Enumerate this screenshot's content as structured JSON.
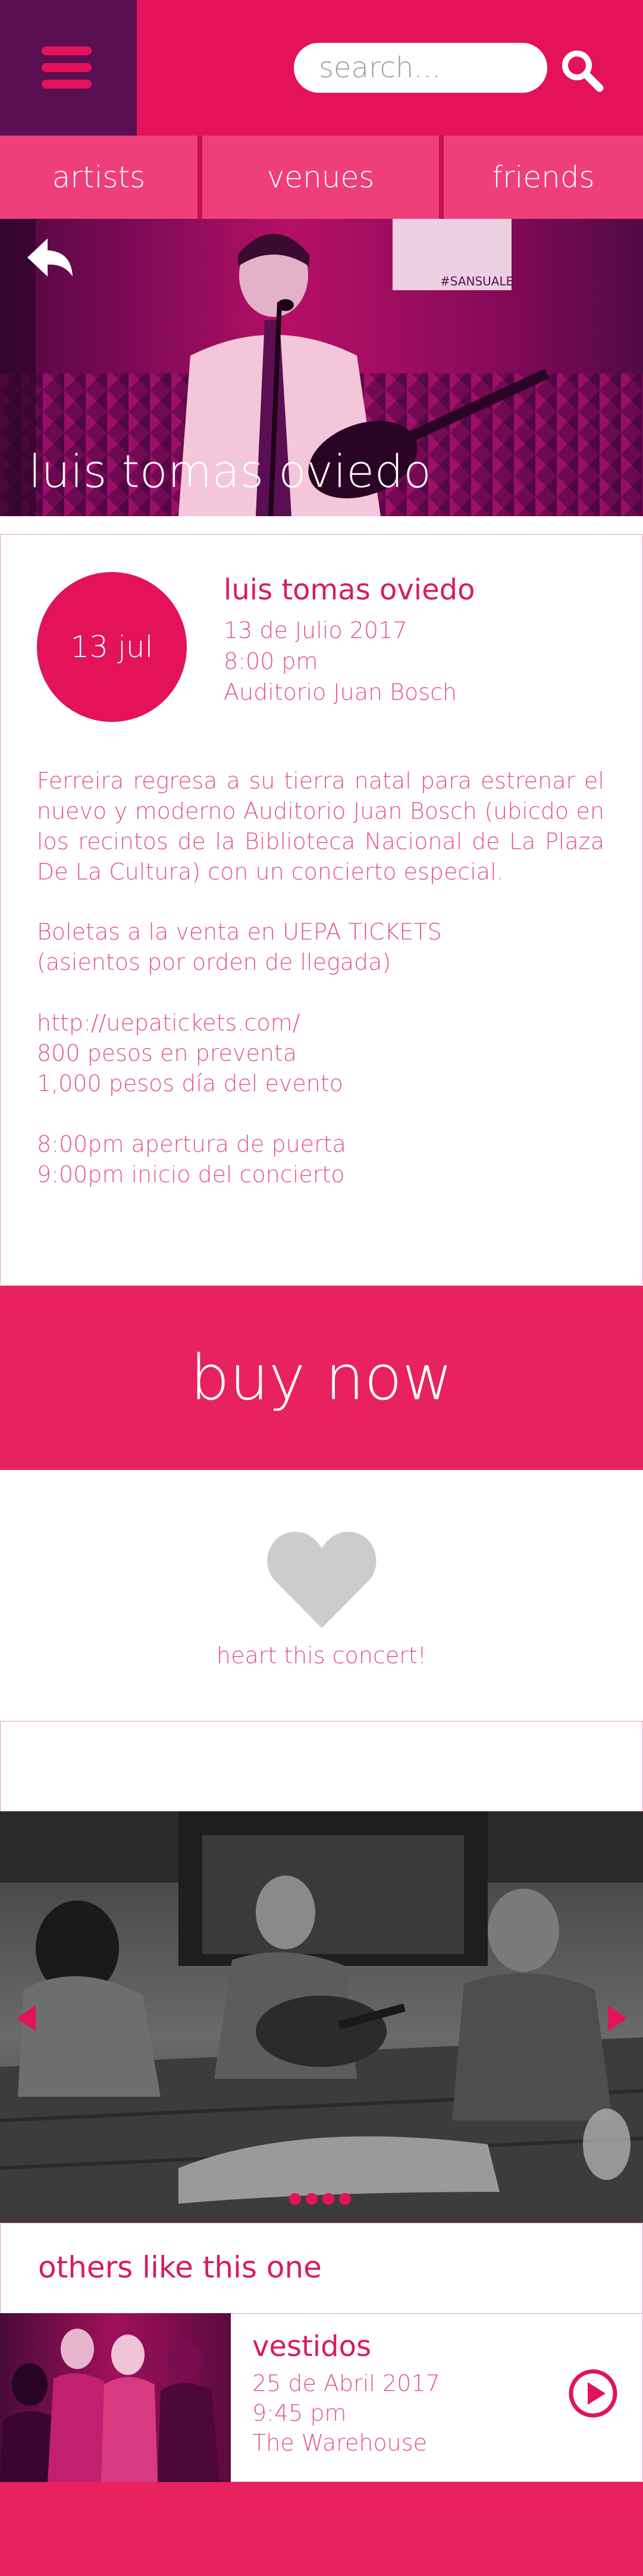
{
  "header": {
    "menu_icon": "hamburger-menu-icon",
    "search_placeholder": "search...",
    "search_icon": "search-icon"
  },
  "tabs": [
    {
      "label": "artists"
    },
    {
      "label": "venues"
    },
    {
      "label": "friends"
    }
  ],
  "hero": {
    "title": "luis tomas oviedo",
    "back_icon": "back-arrow-icon"
  },
  "event": {
    "date_badge": "13 jul",
    "title": "luis tomas oviedo",
    "date": "13 de Julio 2017",
    "time": "8:00 pm",
    "venue": "Auditorio Juan Bosch",
    "description": "Ferreira regresa a su tierra natal para estrenar el nuevo y moderno Auditorio Juan Bosch (ubicdo en los recintos de la Biblioteca Nacional de La Plaza De La Cultura) con un concierto especial.",
    "tickets_line1": "Boletas a la venta en UEPA TICKETS",
    "tickets_line2": "(asientos por orden de llegada)",
    "url": "http://uepatickets.com/",
    "price_presale": "800 pesos en preventa",
    "price_day": "1,000 pesos día del evento",
    "doors": "8:00pm apertura de puerta",
    "start": "9:00pm inicio del concierto"
  },
  "buy_button": "buy now",
  "heart": {
    "icon": "heart-icon",
    "label": "heart this concert!"
  },
  "gallery": {
    "slide_count": 4,
    "active_slide": 1
  },
  "others": {
    "title": "others like this one",
    "items": [
      {
        "title": "vestidos",
        "date": "25 de Abril 2017",
        "time": "9:45 pm",
        "venue": "The Warehouse",
        "action_icon": "play-icon"
      }
    ]
  },
  "colors": {
    "primary": "#e3125a",
    "dark_purple": "#5a0f52",
    "tab": "#ef3f7a",
    "text_pink": "#e4548a",
    "heart_grey": "#cccccc"
  }
}
